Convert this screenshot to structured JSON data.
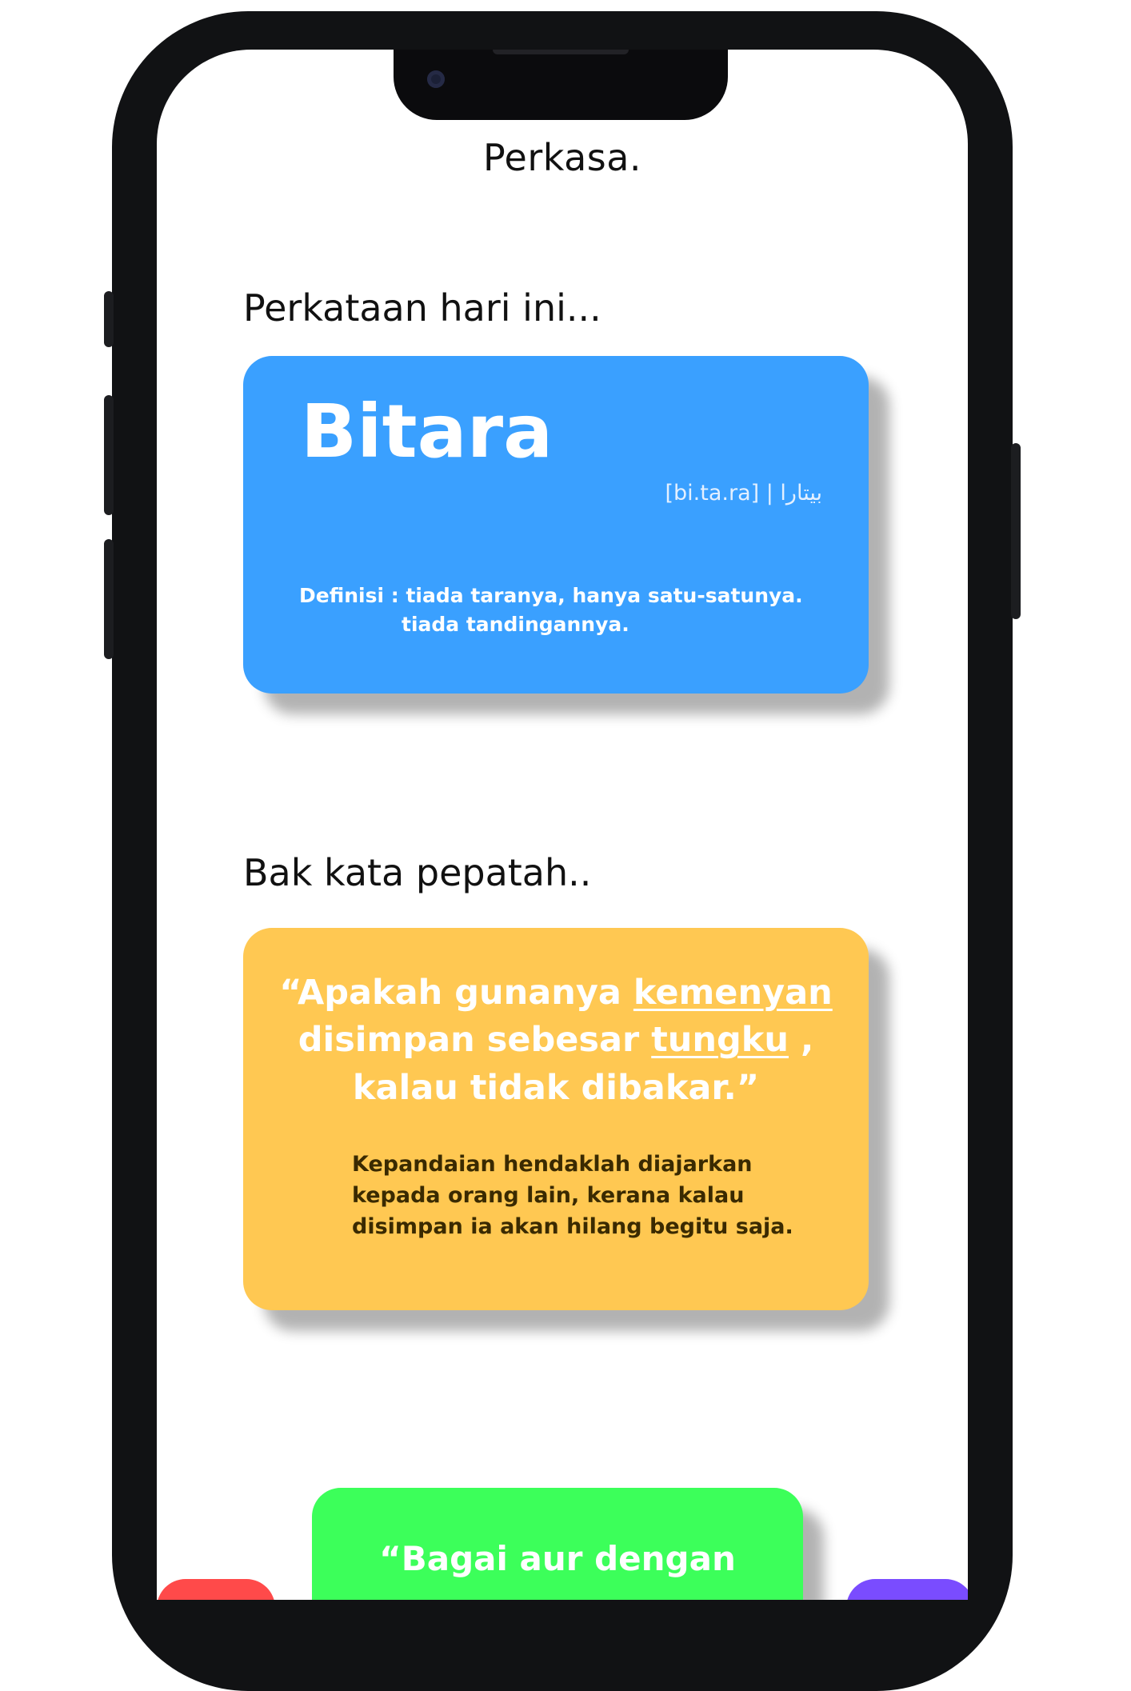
{
  "app": {
    "title": "Perkasa."
  },
  "word_of_day": {
    "heading": "Perkataan hari ini...",
    "word": "Bitara",
    "pronunciation": "[bi.ta.ra] | بيتارا",
    "definition_line1": "Definisi : tiada taranya, hanya satu-satunya.",
    "definition_line2": "tiada tandingannya."
  },
  "proverb": {
    "heading": "Bak kata pepatah..",
    "quote_part1": "“Apakah gunanya ",
    "quote_highlight1": "kemenyan",
    "quote_part2": "disimpan sebesar ",
    "quote_highlight2": "tungku",
    "quote_part3": " ,",
    "quote_part4": "kalau tidak dibakar.”",
    "meaning_line1": "Kepandaian hendaklah diajarkan",
    "meaning_line2": "kepada orang lain, kerana kalau",
    "meaning_line3": "disimpan ia akan hilang begitu saja."
  },
  "next_proverb": {
    "quote_start": "“Bagai aur dengan"
  },
  "colors": {
    "word_card": "#3aa0ff",
    "proverb_card": "#ffc852",
    "next_card": "#3cff5a",
    "left_peek_card": "#ff4a4a",
    "right_peek_card": "#7a4cff"
  }
}
